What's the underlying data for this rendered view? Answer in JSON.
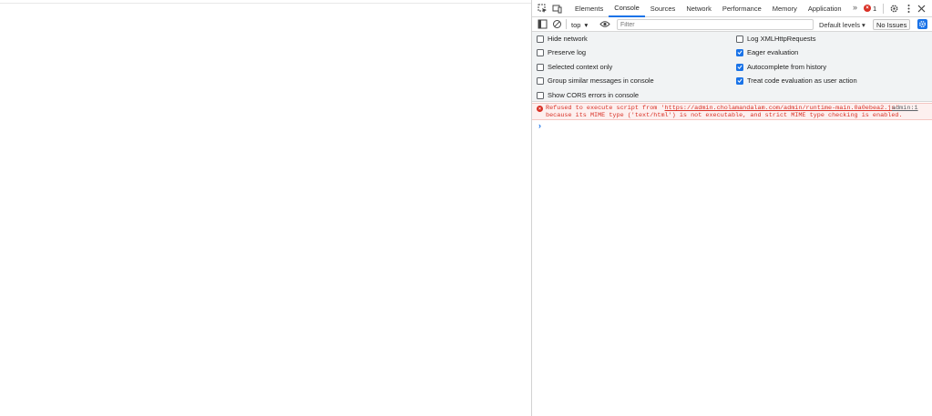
{
  "devtools": {
    "tabs": [
      {
        "label": "Elements",
        "active": false
      },
      {
        "label": "Console",
        "active": true
      },
      {
        "label": "Sources",
        "active": false
      },
      {
        "label": "Network",
        "active": false
      },
      {
        "label": "Performance",
        "active": false
      },
      {
        "label": "Memory",
        "active": false
      },
      {
        "label": "Application",
        "active": false
      }
    ],
    "more_tabs": "»",
    "error_count": "1",
    "accent_color": "#1a73e8",
    "error_color": "#d93025"
  },
  "toolbar": {
    "context": "top",
    "filter_placeholder": "Filter",
    "levels": "Default levels",
    "issues": "No Issues"
  },
  "settings": {
    "left": [
      {
        "label": "Hide network",
        "checked": false
      },
      {
        "label": "Preserve log",
        "checked": false
      },
      {
        "label": "Selected context only",
        "checked": false
      },
      {
        "label": "Group similar messages in console",
        "checked": false
      },
      {
        "label": "Show CORS errors in console",
        "checked": false
      }
    ],
    "right": [
      {
        "label": "Log XMLHttpRequests",
        "checked": false
      },
      {
        "label": "Eager evaluation",
        "checked": true
      },
      {
        "label": "Autocomplete from history",
        "checked": true
      },
      {
        "label": "Treat code evaluation as user action",
        "checked": true
      }
    ]
  },
  "console": {
    "error": {
      "prefix": "Refused to execute script from '",
      "url": "https://admin.cholamandalam.com/admin/runtime-main.0a0ebea2.js",
      "suffix": "'",
      "line2": "because its MIME type ('text/html') is not executable, and strict MIME type checking is enabled.",
      "source": "admin:1"
    },
    "prompt": "›"
  }
}
